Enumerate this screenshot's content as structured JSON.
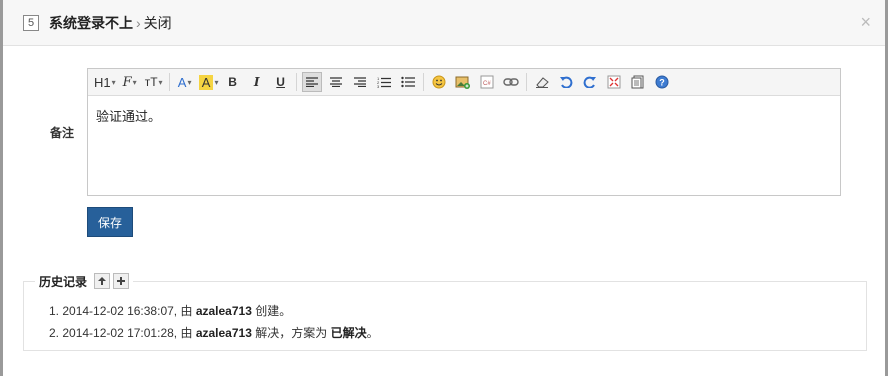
{
  "dialog": {
    "id": "5",
    "title_bold": "系统登录不上",
    "separator": "›",
    "title_action": "关闭",
    "close_glyph": "×"
  },
  "form": {
    "remark_label": "备注",
    "remark_value": "验证通过。",
    "save_label": "保存"
  },
  "toolbar": {
    "heading": "H1",
    "font_family": "F",
    "font_size": "тT",
    "font_color": "A",
    "highlight": "A",
    "bold": "B",
    "italic": "I",
    "underline": "U",
    "icons": [
      "align-left-icon",
      "align-center-icon",
      "align-right-icon",
      "ordered-list-icon",
      "unordered-list-icon",
      "emoticon-icon",
      "image-icon",
      "code-icon",
      "link-icon",
      "eraser-icon",
      "undo-icon",
      "redo-icon",
      "fullscreen-icon",
      "source-icon",
      "help-icon"
    ],
    "colors": {
      "highlight": "#f5d442",
      "accent_blue": "#2f6fcf"
    }
  },
  "history": {
    "title": "历史记录",
    "items": [
      {
        "index": "1.",
        "time": "2014-12-02 16:38:07, 由",
        "user": "azalea713",
        "action": "创建。",
        "extra": "",
        "result": "",
        "end": ""
      },
      {
        "index": "2.",
        "time": "2014-12-02 17:01:28, 由",
        "user": "azalea713",
        "action": "解决，方案为",
        "extra": "",
        "result": "已解决",
        "end": "。"
      }
    ]
  }
}
